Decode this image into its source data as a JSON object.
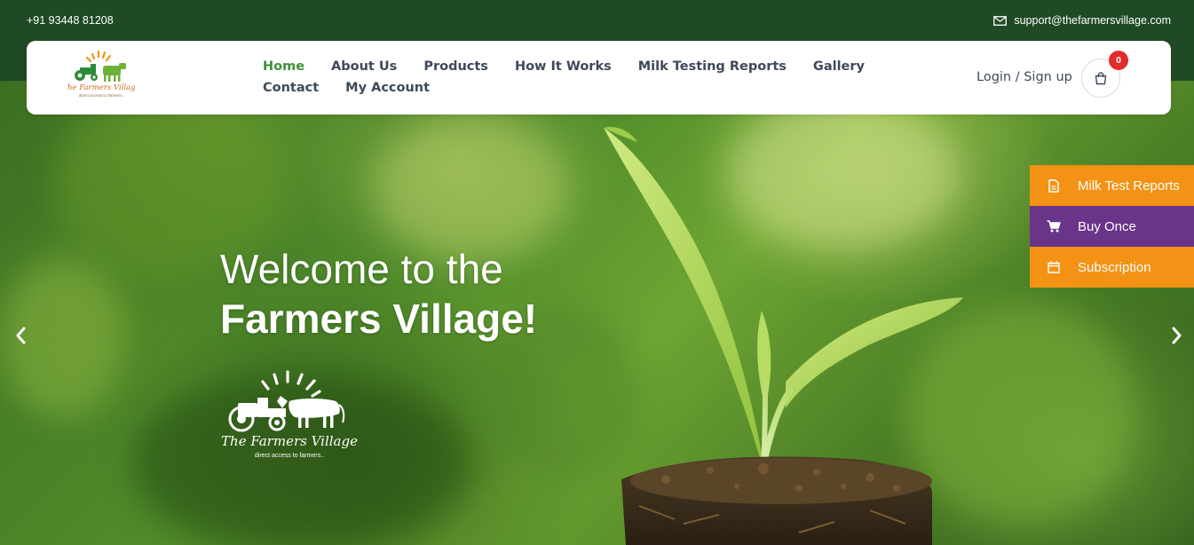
{
  "topbar": {
    "phone": "+91 93448 81208",
    "email": "support@thefarmersvillage.com"
  },
  "logo": {
    "brand": "The Farmers Village",
    "tagline": "direct access to farmers..",
    "icon": "tractor-cow-logo"
  },
  "nav": {
    "items": [
      {
        "label": "Home",
        "active": true
      },
      {
        "label": "About Us"
      },
      {
        "label": "Products"
      },
      {
        "label": "How It Works"
      },
      {
        "label": "Milk Testing Reports"
      },
      {
        "label": "Gallery"
      },
      {
        "label": "Contact"
      },
      {
        "label": "My Account"
      }
    ],
    "login_label": "Login / Sign up",
    "cart_count": "0"
  },
  "hero": {
    "line1": "Welcome to the",
    "line2": "Farmers Village!",
    "logo_brand": "The Farmers Village",
    "logo_tagline": "direct access to farmers.."
  },
  "side_actions": [
    {
      "label": "Milk Test Reports",
      "icon": "document-icon",
      "color": "#f39214"
    },
    {
      "label": "Buy Once",
      "icon": "cart-icon",
      "color": "#6a3489"
    },
    {
      "label": "Subscription",
      "icon": "calendar-icon",
      "color": "#f39214"
    }
  ],
  "colors": {
    "topbar": "#1f4a25",
    "nav_active": "#3f8f3a",
    "nav_text": "#3e4a5a",
    "badge": "#e32b2b"
  }
}
